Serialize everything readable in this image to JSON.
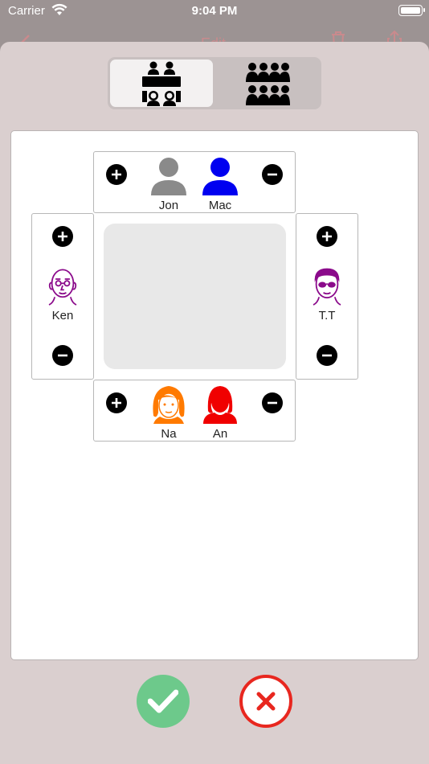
{
  "status_bar": {
    "carrier": "Carrier",
    "time": "9:04 PM"
  },
  "behind_nav": {
    "title": "Edit"
  },
  "segmented": {
    "options": [
      {
        "icon": "two-row-table-icon",
        "selected": true
      },
      {
        "icon": "crowd-icon",
        "selected": false
      }
    ]
  },
  "table": {
    "top": {
      "seats": [
        {
          "name": "Jon",
          "color": "#8a8a8a"
        },
        {
          "name": "Mac",
          "color": "#0000f0"
        }
      ]
    },
    "left": {
      "seats": [
        {
          "name": "Ken",
          "color": "#8b0a8b"
        }
      ]
    },
    "right": {
      "seats": [
        {
          "name": "T.T",
          "color": "#8b0a8b"
        }
      ]
    },
    "bottom": {
      "seats": [
        {
          "name": "Na",
          "color": "#ff7a00"
        },
        {
          "name": "An",
          "color": "#f00000"
        }
      ]
    }
  },
  "colors": {
    "confirm": "#6dc98b",
    "cancel": "#e8271f",
    "sheet": "#dacfcf"
  }
}
